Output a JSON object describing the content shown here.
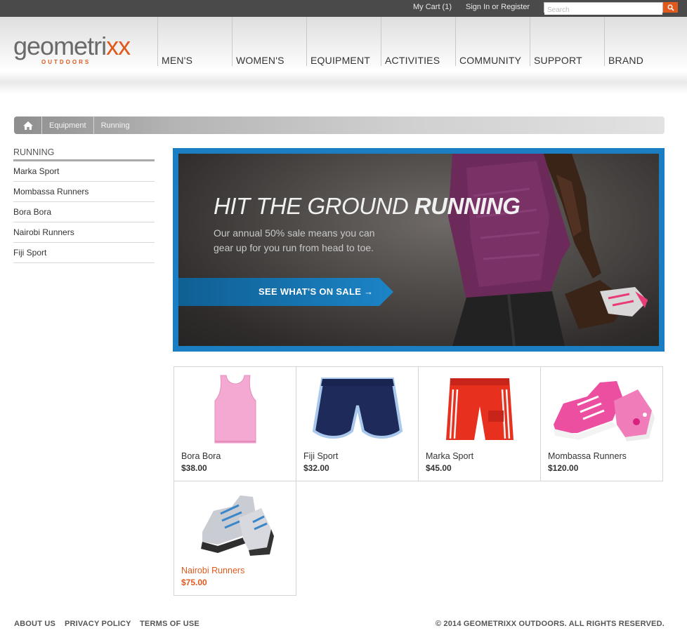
{
  "topbar": {
    "cart_label": "My Cart (1)",
    "signin_label": "Sign In or Register",
    "search_placeholder": "Search",
    "search_icon": "search-icon"
  },
  "brand": {
    "name_main": "geometri",
    "name_accent": "xx",
    "tagline": "OUTDOORS",
    "accent_color": "#e05a1e"
  },
  "nav": {
    "items": [
      {
        "label": "MEN'S"
      },
      {
        "label": "WOMEN'S"
      },
      {
        "label": "EQUIPMENT"
      },
      {
        "label": "ACTIVITIES"
      },
      {
        "label": "COMMUNITY"
      },
      {
        "label": "SUPPORT"
      },
      {
        "label": "BRAND"
      }
    ]
  },
  "breadcrumb": {
    "home_icon": "home-icon",
    "items": [
      {
        "label": "Equipment"
      },
      {
        "label": "Running"
      }
    ]
  },
  "sidebar": {
    "title": "RUNNING",
    "items": [
      {
        "label": "Marka Sport"
      },
      {
        "label": "Mombassa Runners"
      },
      {
        "label": "Bora Bora"
      },
      {
        "label": "Nairobi Runners"
      },
      {
        "label": "Fiji Sport"
      }
    ]
  },
  "hero": {
    "title_light": "HIT THE GROUND ",
    "title_bold": "RUNNING",
    "text": "Our annual 50% sale means you can gear up for you run from head to toe.",
    "cta_label": "SEE WHAT'S ON SALE",
    "cta_icon": "arrow-right-icon",
    "frame_color": "#1c7ec2"
  },
  "products": [
    {
      "name": "Bora Bora",
      "price": "$38.00",
      "icon": "tank-top-icon",
      "active": false
    },
    {
      "name": "Fiji Sport",
      "price": "$32.00",
      "icon": "running-shorts-icon",
      "active": false
    },
    {
      "name": "Marka Sport",
      "price": "$45.00",
      "icon": "board-shorts-icon",
      "active": false
    },
    {
      "name": "Mombassa Runners",
      "price": "$120.00",
      "icon": "pink-sneaker-icon",
      "active": false
    },
    {
      "name": "Nairobi Runners",
      "price": "$75.00",
      "icon": "running-shoes-icon",
      "active": true
    }
  ],
  "footer": {
    "links": [
      {
        "label": "ABOUT US"
      },
      {
        "label": "PRIVACY POLICY"
      },
      {
        "label": "TERMS OF USE"
      }
    ],
    "copyright": "© 2014 GEOMETRIXX OUTDOORS. ALL RIGHTS RESERVED."
  }
}
